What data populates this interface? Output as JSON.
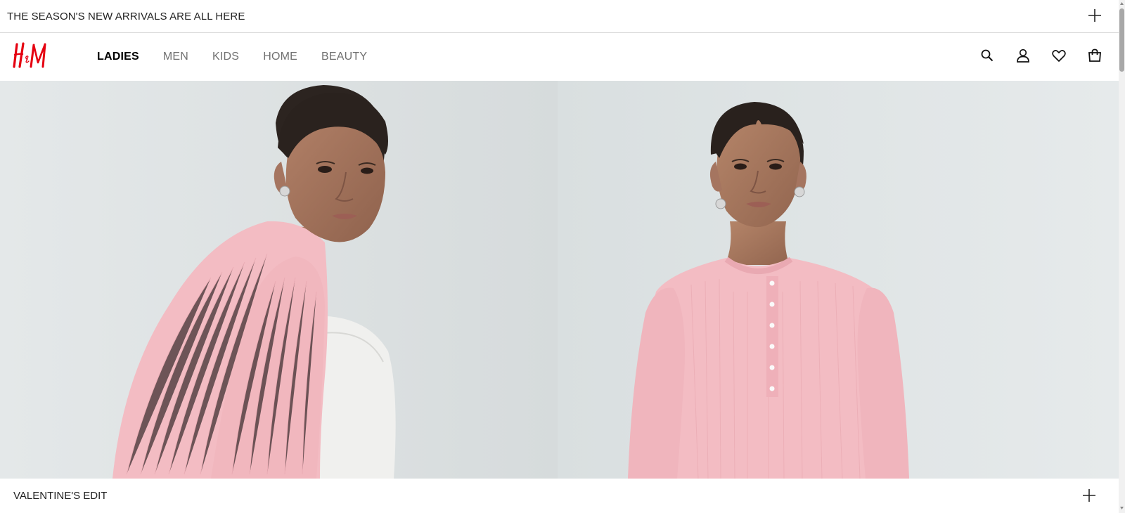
{
  "announcement": {
    "text": "THE SEASON'S NEW ARRIVALS ARE ALL HERE",
    "toggle_icon": "plus-icon"
  },
  "brand": {
    "name": "H&M",
    "color": "#e50010"
  },
  "nav": {
    "items": [
      {
        "label": "LADIES",
        "active": true
      },
      {
        "label": "MEN",
        "active": false
      },
      {
        "label": "KIDS",
        "active": false
      },
      {
        "label": "HOME",
        "active": false
      },
      {
        "label": "BEAUTY",
        "active": false
      }
    ],
    "icons": [
      "search-icon",
      "account-icon",
      "favorites-icon",
      "shopping-bag-icon"
    ]
  },
  "hero": {
    "images": [
      "model-side-view-pink-rib-sweater",
      "model-front-view-pink-henley-top"
    ]
  },
  "section": {
    "title": "VALENTINE'S EDIT",
    "toggle_icon": "plus-icon"
  },
  "colors": {
    "sweater_pink": "#f3bcc3",
    "backdrop": "#dfe3e4",
    "text": "#222222"
  }
}
